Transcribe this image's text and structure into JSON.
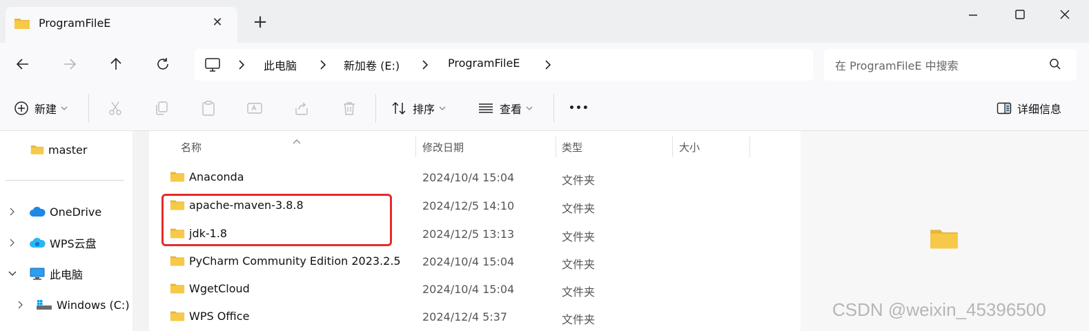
{
  "window": {
    "tab_title": "ProgramFileE",
    "close_tab": "✕",
    "new_tab": "+"
  },
  "address": {
    "crumbs": [
      "此电脑",
      "新加卷 (E:)",
      "ProgramFileE"
    ]
  },
  "search": {
    "placeholder": "在 ProgramFileE 中搜索"
  },
  "toolbar": {
    "new_label": "新建",
    "sort_label": "排序",
    "view_label": "查看",
    "more_label": "•••",
    "details_label": "详细信息"
  },
  "sidebar": {
    "items": [
      {
        "label": "master",
        "icon": "folder-icon"
      },
      {
        "label": "OneDrive",
        "icon": "onedrive-icon"
      },
      {
        "label": "WPS云盘",
        "icon": "wps-cloud-icon"
      },
      {
        "label": "此电脑",
        "icon": "computer-icon"
      },
      {
        "label": "Windows (C:)",
        "icon": "drive-icon"
      }
    ]
  },
  "columns": {
    "name": "名称",
    "modified": "修改日期",
    "type": "类型",
    "size": "大小"
  },
  "files": [
    {
      "name": "Anaconda",
      "modified": "2024/10/4 15:04",
      "type": "文件夹"
    },
    {
      "name": "apache-maven-3.8.8",
      "modified": "2024/12/5 14:10",
      "type": "文件夹"
    },
    {
      "name": "jdk-1.8",
      "modified": "2024/12/5 13:13",
      "type": "文件夹"
    },
    {
      "name": "PyCharm Community Edition 2023.2.5",
      "modified": "2024/10/4 15:04",
      "type": "文件夹"
    },
    {
      "name": "WgetCloud",
      "modified": "2024/10/4 15:04",
      "type": "文件夹"
    },
    {
      "name": "WPS Office",
      "modified": "2024/12/4 5:37",
      "type": "文件夹"
    }
  ],
  "colors": {
    "folder": "#f7c948",
    "highlight": "#e52a2a",
    "accent": "#0067c0"
  },
  "watermark": "CSDN @weixin_45396500"
}
